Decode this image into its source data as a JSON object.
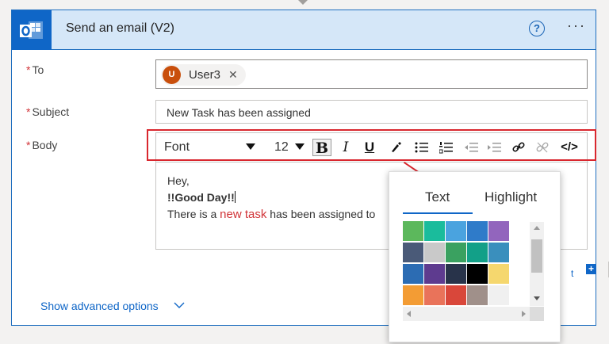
{
  "action": {
    "title": "Send an email (V2)",
    "help_glyph": "?",
    "more_glyph": "···",
    "brand_color": "#0f66c7"
  },
  "fields": {
    "required_mark": "*",
    "to_label": "To",
    "subject_label": "Subject",
    "body_label": "Body",
    "to_recipient": {
      "initial": "U",
      "name": "User3",
      "remove_glyph": "✕"
    },
    "subject_value": "New Task has been assigned"
  },
  "toolbar": {
    "font": "Font",
    "size": "12",
    "bold": "B",
    "italic": "I",
    "underline": "U",
    "code": "</>"
  },
  "body": {
    "line1": "Hey,",
    "line2": "!!Good Day!!",
    "line3_before": "There is a ",
    "line3_colored": "new task",
    "line3_after": " has been assigned to"
  },
  "editor_link": {
    "text": "t",
    "add_glyph": "+"
  },
  "advanced": {
    "label": "Show advanced options"
  },
  "color_picker": {
    "tabs": [
      "Text",
      "Highlight"
    ],
    "active_tab": "Text",
    "swatches": [
      [
        "#5cb85c",
        "#1abc9c",
        "#4aa3df",
        "#2f7bc9",
        "#9265bd"
      ],
      [
        "#4a5a78",
        "#c9c9c9",
        "#3aa160",
        "#12a088",
        "#3a8fbd"
      ],
      [
        "#2c6cb3",
        "#5e3b8f",
        "#28334a",
        "#000000",
        "#f5d76e"
      ],
      [
        "#f39c34",
        "#e9735a",
        "#d9473a",
        "#a0908a",
        "#f0f0f0"
      ]
    ]
  }
}
